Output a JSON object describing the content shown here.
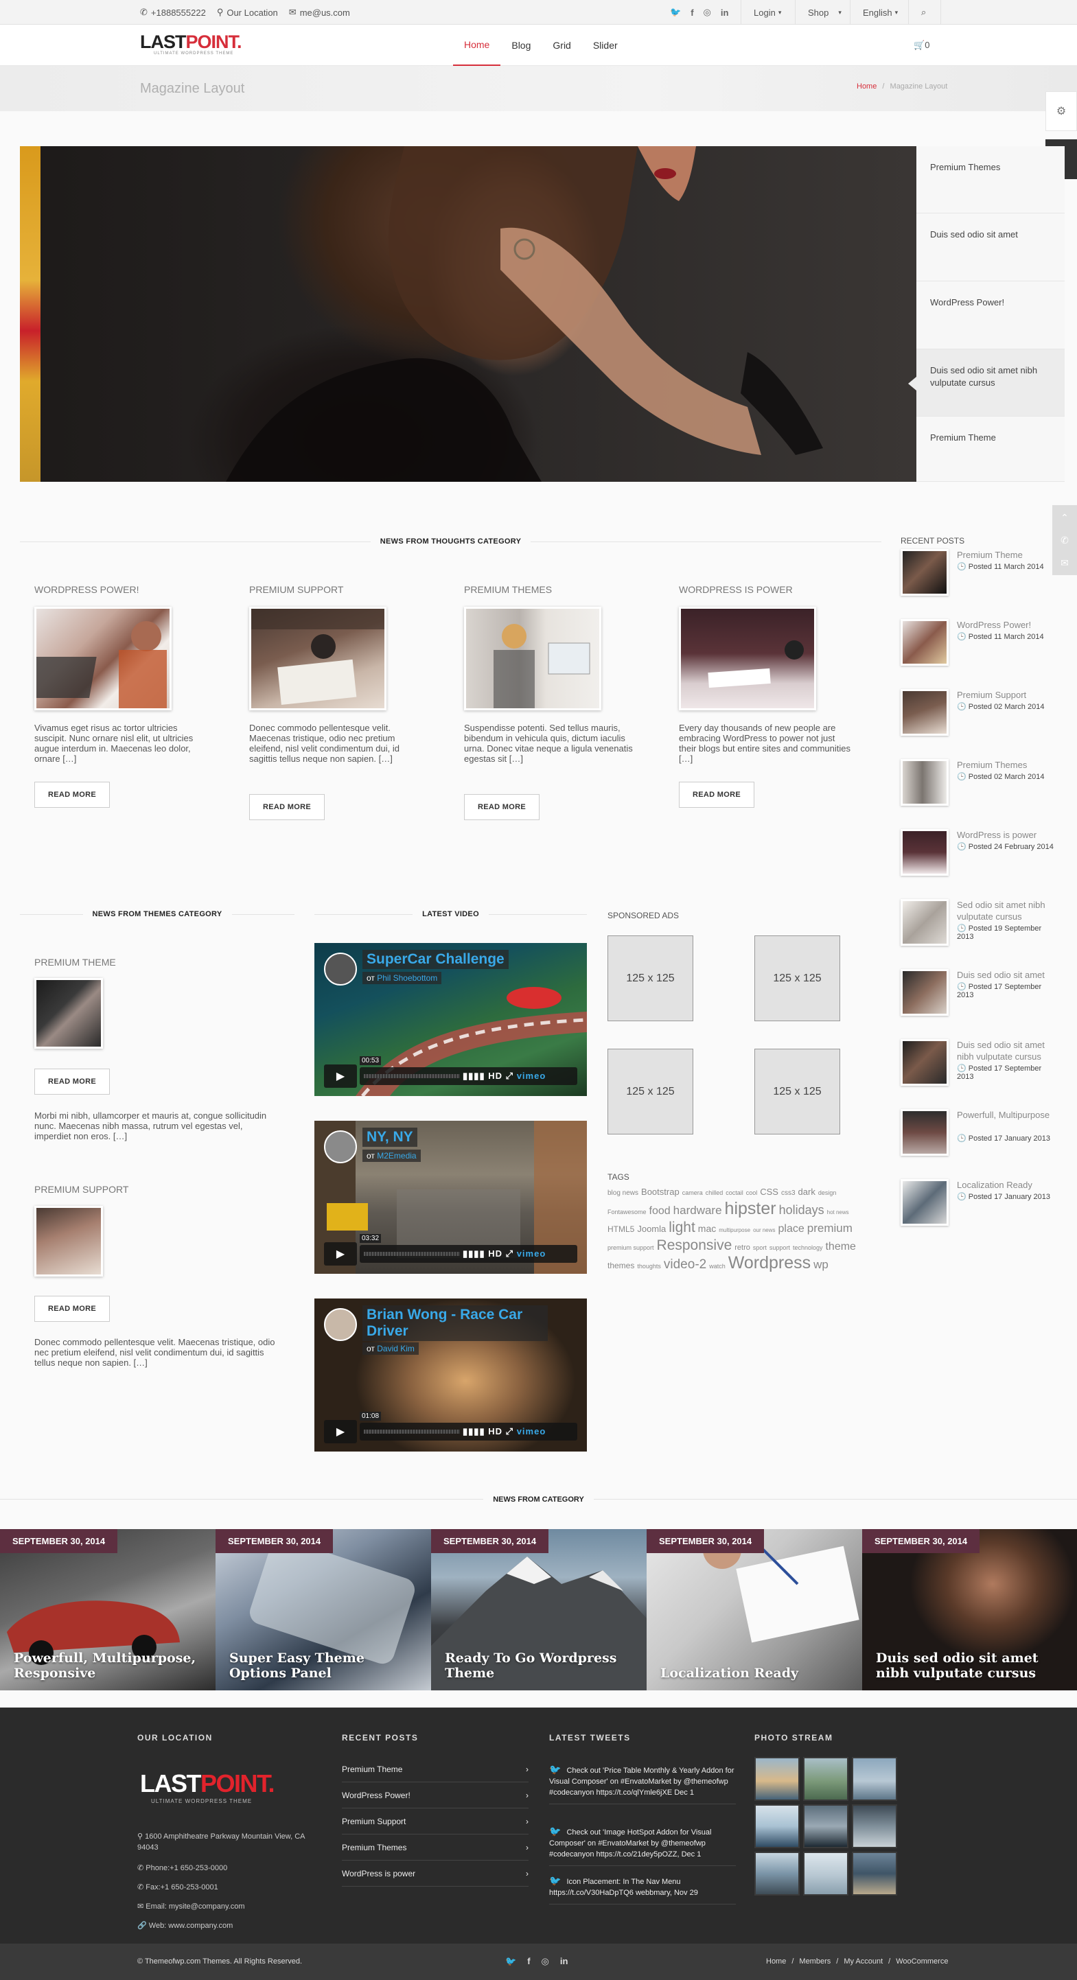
{
  "topbar": {
    "phone": "+1888555222",
    "location": "Our Location",
    "email": "me@us.com",
    "login": "Login",
    "shop": "Shop",
    "language": "English"
  },
  "header": {
    "logo_a": "LAST",
    "logo_b": "POINT.",
    "logo_tag": "ULTIMATE WORDPRESS THEME",
    "nav": [
      "Home",
      "Blog",
      "Grid",
      "Slider"
    ],
    "cart": "0"
  },
  "titlebar": {
    "title": "Magazine Layout",
    "bc_home": "Home",
    "bc_sep": "/",
    "bc_current": "Magazine Layout"
  },
  "slider": {
    "tabs": [
      "Premium Themes",
      "Duis sed odio sit amet",
      "WordPress Power!",
      "Duis sed odio sit amet nibh vulputate cursus",
      "Premium Theme"
    ]
  },
  "thoughts": {
    "heading": "NEWS FROM THOUGHTS CATEGORY",
    "read_more": "READ MORE",
    "posts": [
      {
        "title": "WORDPRESS POWER!",
        "excerpt": "Vivamus eget risus ac tortor ultricies suscipit. Nunc ornare nisl elit, ut ultricies augue interdum in. Maecenas leo dolor, ornare […]"
      },
      {
        "title": "PREMIUM SUPPORT",
        "excerpt": "Donec commodo pellentesque velit. Maecenas tristique, odio nec pretium eleifend, nisl velit condimentum dui, id sagittis tellus neque non sapien. […]"
      },
      {
        "title": "PREMIUM THEMES",
        "excerpt": "Suspendisse potenti. Sed tellus mauris, bibendum in vehicula quis, dictum iaculis urna. Donec vitae neque a ligula venenatis egestas sit […]"
      },
      {
        "title": "WORDPRESS IS POWER",
        "excerpt": "Every day thousands of new people are embracing WordPress to power not just their blogs but entire sites and communities […]"
      }
    ]
  },
  "recent": {
    "heading": "RECENT POSTS",
    "items": [
      {
        "title": "Premium Theme",
        "date": "Posted 11 March 2014"
      },
      {
        "title": "WordPress Power!",
        "date": "Posted 11 March 2014"
      },
      {
        "title": "Premium Support",
        "date": "Posted 02 March 2014"
      },
      {
        "title": "Premium Themes",
        "date": "Posted 02 March 2014"
      },
      {
        "title": "WordPress is power",
        "date": "Posted 24 February 2014"
      },
      {
        "title": "Sed odio sit amet nibh vulputate cursus",
        "date": "Posted 19 September 2013"
      },
      {
        "title": "Duis sed odio sit amet",
        "date": "Posted 17 September 2013"
      },
      {
        "title": "Duis sed odio sit amet nibh vulputate cursus",
        "date": "Posted 17 September 2013"
      },
      {
        "title": "Powerfull, Multipurpose",
        "date": "Posted 17 January 2013"
      },
      {
        "title": "Localization Ready",
        "date": "Posted 17 January 2013"
      }
    ]
  },
  "themes": {
    "heading": "NEWS FROM THEMES CATEGORY",
    "read_more": "READ MORE",
    "posts": [
      {
        "title": "PREMIUM THEME",
        "excerpt": "Morbi mi nibh, ullamcorper et mauris at, congue sollicitudin nunc. Maecenas nibh massa, rutrum vel egestas vel, imperdiet non eros. […]"
      },
      {
        "title": "PREMIUM SUPPORT",
        "excerpt": "Donec commodo pellentesque velit. Maecenas tristique, odio nec pretium eleifend, nisl velit condimentum dui, id sagittis tellus neque non sapien. […]"
      }
    ]
  },
  "video": {
    "heading": "LATEST VIDEO",
    "from": "от",
    "items": [
      {
        "title": "SuperCar Challenge",
        "author": "Phil Shoebottom",
        "time": "00:53"
      },
      {
        "title": "NY, NY",
        "author": "M2Emedia",
        "time": "03:32"
      },
      {
        "title": "Brian Wong - Race Car Driver",
        "author": "David Kim",
        "time": "01:08"
      }
    ],
    "hd": "HD",
    "brand": "vimeo"
  },
  "ads": {
    "heading": "SPONSORED ADS",
    "label": "125 x 125"
  },
  "tags": {
    "heading": "TAGS",
    "items": [
      "blog news",
      "Bootstrap",
      "camera",
      "chilled",
      "coctail",
      "cool",
      "CSS",
      "css3",
      "dark",
      "design",
      "Fontawesome",
      "food",
      "hardware",
      "hipster",
      "holidays",
      "hot news",
      "HTML5",
      "Joomla",
      "light",
      "mac",
      "multipurpose",
      "our news",
      "place",
      "premium",
      "premium support",
      "Responsive",
      "retro",
      "sport",
      "support",
      "technology",
      "theme",
      "themes",
      "thoughts",
      "video-2",
      "watch",
      "Wordpress",
      "wp"
    ]
  },
  "category": {
    "heading": "NEWS FROM CATEGORY",
    "items": [
      {
        "date": "SEPTEMBER 30, 2014",
        "title": "Powerfull, Multipurpose, Responsive"
      },
      {
        "date": "SEPTEMBER 30, 2014",
        "title": "Super Easy Theme Options Panel"
      },
      {
        "date": "SEPTEMBER 30, 2014",
        "title": "Ready To Go Wordpress Theme"
      },
      {
        "date": "SEPTEMBER 30, 2014",
        "title": "Localization Ready"
      },
      {
        "date": "SEPTEMBER 30, 2014",
        "title": "Duis sed odio sit amet nibh vulputate cursus"
      }
    ]
  },
  "footer": {
    "location_h": "OUR LOCATION",
    "recent_h": "RECENT POSTS",
    "tweets_h": "LATEST TWEETS",
    "photos_h": "PHOTO STREAM",
    "logo_a": "LAST",
    "logo_b": "POINT.",
    "logo_tag": "ULTIMATE WORDPRESS THEME",
    "address": "1600 Amphitheatre Parkway Mountain View, CA 94043",
    "phone": "Phone:+1 650-253-0000",
    "fax": "Fax:+1 650-253-0001",
    "email": "Email: mysite@company.com",
    "web": "Web: www.company.com",
    "links": [
      "Premium Theme",
      "WordPress Power!",
      "Premium Support",
      "Premium Themes",
      "WordPress is power"
    ],
    "tweets": [
      "Check out 'Price Table Monthly & Yearly Addon for Visual Composer' on #EnvatoMarket by @themeofwp #codecanyon https://t.co/qlYmle6jXE Dec 1",
      "Check out 'Image HotSpot Addon for Visual Composer' on #EnvatoMarket by @themeofwp #codecanyon https://t.co/21dey5pOZZ, Dec 1",
      "Icon Placement: In The Nav Menu https://t.co/V30HaDpTQ6 webbmary, Nov 29"
    ],
    "copyright": "© Themeofwp.com Themes. All Rights Reserved.",
    "bottom_links": [
      "Home",
      "Members",
      "My Account",
      "WooCommerce"
    ]
  }
}
